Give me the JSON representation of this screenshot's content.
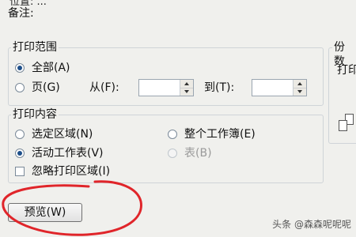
{
  "header": {
    "partial_top_text": "位置:     ...  ",
    "remark_label": "备注:"
  },
  "print_range": {
    "legend": "打印范围",
    "all_label": "全部(A)",
    "pages_label": "页(G)",
    "from_label": "从(F):",
    "to_label": "到(T):",
    "from_value": "",
    "to_value": ""
  },
  "print_content": {
    "legend": "打印内容",
    "selection_label": "选定区域(N)",
    "entire_workbook_label": "整个工作簿(E)",
    "active_sheet_label": "活动工作表(V)",
    "table_label": "表(B)",
    "ignore_print_area_label": "忽略打印区域(I)"
  },
  "copies": {
    "legend": "份数",
    "count_label": "打印"
  },
  "preview_button": "预览(W)",
  "watermark": "头条 @森森呢呢呢",
  "colors": {
    "annotation_red": "#e0252a",
    "dialog_bg": "#f0f0ed"
  }
}
